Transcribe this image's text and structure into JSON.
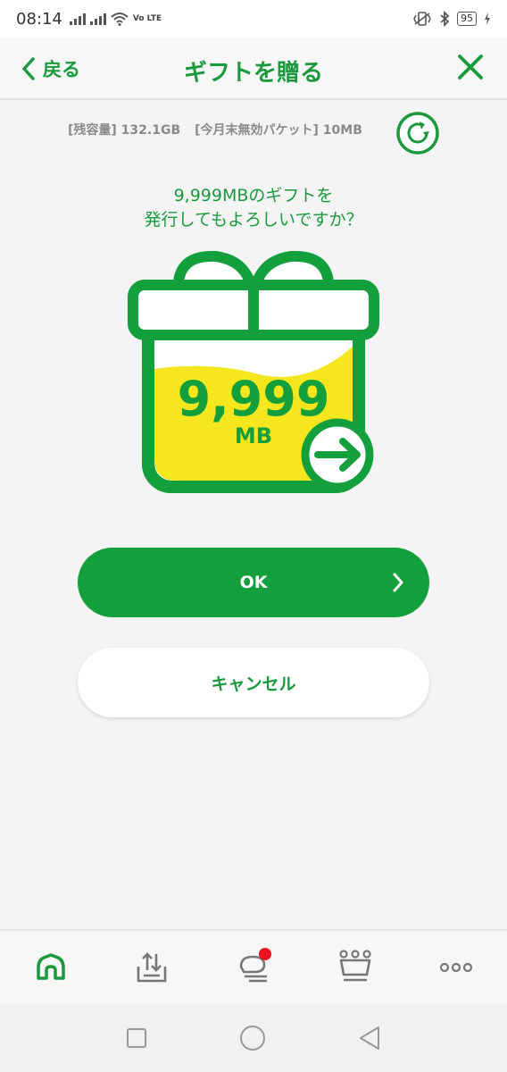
{
  "status_bar": {
    "time": "08:14",
    "battery": "95",
    "network": "Vo LTE"
  },
  "header": {
    "back_label": "戻る",
    "title": "ギフトを贈る"
  },
  "info": {
    "remaining": "[残容量] 132.1GB",
    "expiring": "[今月末無効パケット] 10MB"
  },
  "question": {
    "line1": "9,999MBのギフトを",
    "line2": "発行してもよろしいですか？"
  },
  "gift": {
    "amount": "9,999",
    "unit": "MB"
  },
  "buttons": {
    "ok_label": "OK",
    "cancel_label": "キャンセル"
  },
  "nav": {
    "items": [
      "home-icon",
      "upload-tray-icon",
      "chat-icon",
      "crown-icon",
      "more-icon"
    ],
    "notification_dot": true
  },
  "colors": {
    "brand_green": "#13a03c",
    "gift_yellow": "#f5e61e",
    "notification_red": "#ee1122"
  }
}
